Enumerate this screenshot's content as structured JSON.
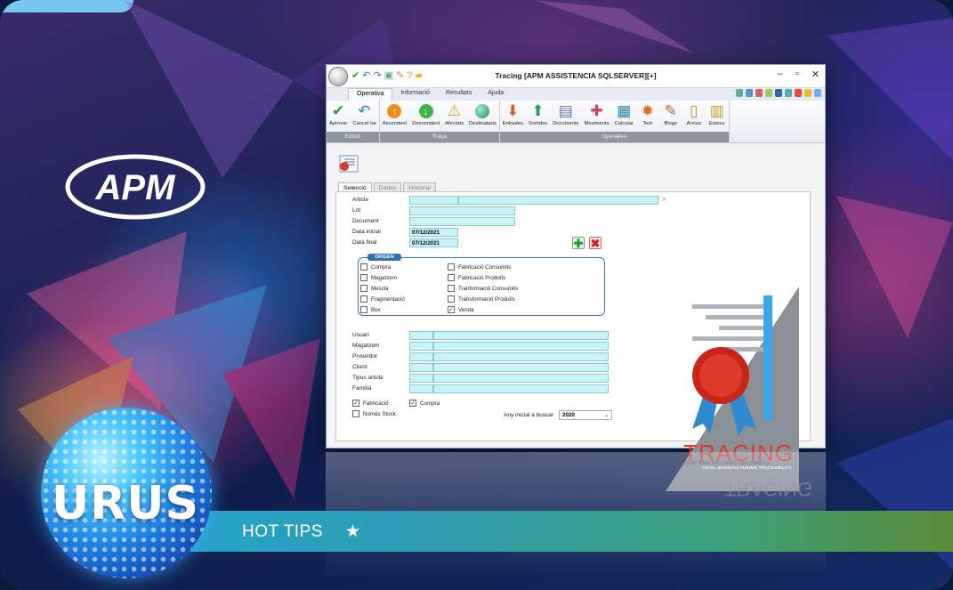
{
  "brand": {
    "logo_text": "APM",
    "badge_text": "URUS",
    "banner_text": "HOT TIPS",
    "banner_star": "★"
  },
  "window": {
    "title": "Tracing [APM ASSISTENCIA SQLSERVER][+]",
    "controls": [
      "–",
      "▫",
      "✕"
    ]
  },
  "ribbon": {
    "tabs": [
      "Operativa",
      "Informació",
      "Resultats",
      "Ajuda"
    ],
    "active_tab": "Operativa",
    "groups": [
      {
        "name": "Edició",
        "buttons": [
          {
            "label": "Aprovar",
            "icon": "checkmark-icon"
          },
          {
            "label": "Cancel·lar",
            "icon": "undo-icon"
          }
        ]
      },
      {
        "name": "Traça",
        "buttons": [
          {
            "label": "Ascendent",
            "icon": "arrow-up-icon"
          },
          {
            "label": "Descendent",
            "icon": "arrow-down-icon"
          },
          {
            "label": "Afectats",
            "icon": "warning-icon"
          },
          {
            "label": "Destinataris",
            "icon": "globe-icon"
          }
        ]
      },
      {
        "name": "Operativa",
        "buttons": [
          {
            "label": "Entrades",
            "icon": "entrades-icon"
          },
          {
            "label": "Sortides",
            "icon": "sortides-icon"
          },
          {
            "label": "Documents",
            "icon": "documents-icon"
          },
          {
            "label": "Moviments",
            "icon": "moviments-icon"
          },
          {
            "label": "Calcular",
            "icon": "calculator-icon"
          },
          {
            "label": "Test",
            "icon": "test-icon"
          },
          {
            "label": "Blogs",
            "icon": "blogs-icon"
          },
          {
            "label": "Arxius",
            "icon": "files-icon"
          },
          {
            "label": "Estocs",
            "icon": "stock-icon"
          }
        ]
      }
    ]
  },
  "tabs": [
    "Selecció",
    "Dades",
    "Historial"
  ],
  "active_form_tab": "Selecció",
  "fields": {
    "article": "Article",
    "lot": "Lot",
    "document": "Document",
    "data_inicial": "Data inicial",
    "data_inicial_value": "07/12/2021",
    "data_final": "Data final",
    "data_final_value": "07/12/2021"
  },
  "origen": {
    "title": "ORIGEN",
    "left": [
      {
        "label": "Compra",
        "checked": false
      },
      {
        "label": "Magatzem",
        "checked": false
      },
      {
        "label": "Mescla",
        "checked": false
      },
      {
        "label": "Fragmentació",
        "checked": false
      },
      {
        "label": "Box",
        "checked": false
      }
    ],
    "right": [
      {
        "label": "Fabricació Consumits",
        "checked": false
      },
      {
        "label": "Fabricació Produïts",
        "checked": false
      },
      {
        "label": "Tranformació Consumits",
        "checked": false
      },
      {
        "label": "Transformació Produïts",
        "checked": false
      },
      {
        "label": "Venda",
        "checked": true
      }
    ]
  },
  "lookups": [
    "Usuari",
    "Magatzem",
    "Proveïdor",
    "Client",
    "Tipus article",
    "Família"
  ],
  "footer": {
    "fabricacio": "Fabricació",
    "compra": "Compra",
    "nomes_stock": "Només Stock",
    "any_label": "Any inicial a buscar",
    "any_value": "2020"
  },
  "tracing_logo": {
    "word": "TRACING",
    "subtitle": "TOTAL MANUFACTURING TRACEABILITY"
  },
  "reflection": {
    "line1": "Només Stock",
    "line2": "Fabricació",
    "line3": "Compra",
    "line4": "Any inicial a buscar",
    "line5": "2020",
    "line6": "TRACING",
    "line7": "TOTAL MANUFACTURING TRACEABILITY"
  },
  "colors": {
    "field_bg": "#c7f4f6",
    "origen_accent": "#2f6fb3",
    "tracing_red": "#d83b2a"
  }
}
